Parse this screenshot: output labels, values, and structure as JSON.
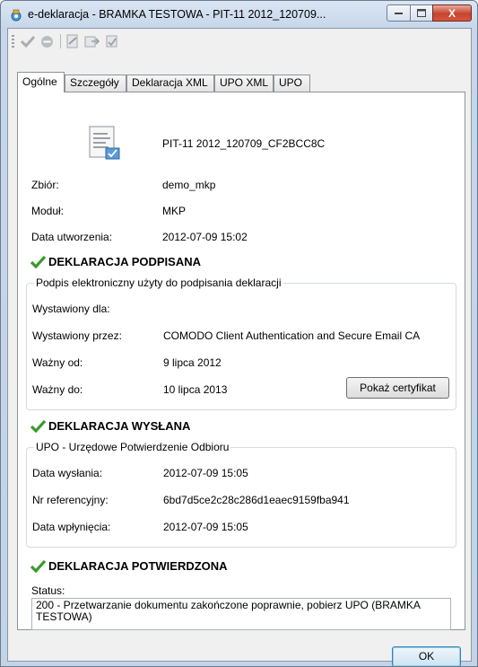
{
  "window": {
    "title": "e-deklaracja - BRAMKA TESTOWA - PIT-11 2012_120709...",
    "close_label": "X"
  },
  "toolbar": {
    "icons": [
      "check-icon",
      "stop-icon",
      "sign-icon",
      "send-icon",
      "receive-icon"
    ]
  },
  "tabs": [
    {
      "label": "Ogólne",
      "active": true
    },
    {
      "label": "Szczegóły"
    },
    {
      "label": "Deklaracja XML"
    },
    {
      "label": "UPO XML"
    },
    {
      "label": "UPO"
    }
  ],
  "general": {
    "document_name": "PIT-11 2012_120709_CF2BCC8C",
    "collection_label": "Zbiór:",
    "collection_value": "demo_mkp",
    "module_label": "Moduł:",
    "module_value": "MKP",
    "created_label": "Data utworzenia:",
    "created_value": "2012-07-09 15:02"
  },
  "signed": {
    "heading": "DEKLARACJA PODPISANA",
    "group_title": "Podpis elektroniczny użyty do podpisania deklaracji",
    "issued_to_label": "Wystawiony dla:",
    "issued_to_value": "",
    "issued_by_label": "Wystawiony przez:",
    "issued_by_value": "COMODO Client Authentication and Secure Email CA",
    "valid_from_label": "Ważny od:",
    "valid_from_value": "9 lipca 2012",
    "valid_to_label": "Ważny do:",
    "valid_to_value": "10 lipca 2013",
    "show_cert_button": "Pokaż certyfikat"
  },
  "sent": {
    "heading": "DEKLARACJA WYSŁANA",
    "group_title": "UPO - Urzędowe Potwierdzenie Odbioru",
    "sent_date_label": "Data wysłania:",
    "sent_date_value": "2012-07-09 15:05",
    "ref_label": "Nr referencyjny:",
    "ref_value": "6bd7d5ce2c28c286d1eaec9159fba941",
    "received_label": "Data wpłynięcia:",
    "received_value": "2012-07-09 15:05"
  },
  "confirmed": {
    "heading": "DEKLARACJA POTWIERDZONA",
    "status_label": "Status:",
    "status_value": "200 - Przetwarzanie dokumentu zakończone poprawnie, pobierz UPO (BRAMKA TESTOWA)"
  },
  "footer": {
    "ok_button": "OK"
  },
  "colors": {
    "check_green": "#3a9a2b",
    "accent_blue": "#3c7fb1"
  }
}
